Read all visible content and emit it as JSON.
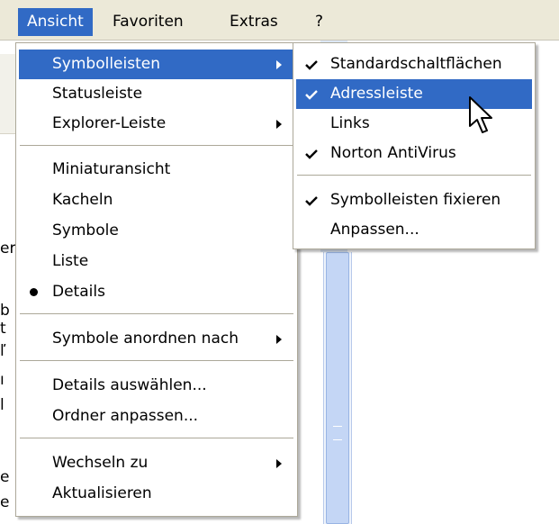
{
  "menubar": {
    "items": [
      {
        "label": "Ansicht",
        "active": true
      },
      {
        "label": "Favoriten",
        "active": false
      },
      {
        "label": "Extras",
        "active": false
      },
      {
        "label": "?",
        "active": false
      }
    ]
  },
  "background": {
    "fragments": [
      "er",
      "b",
      "t",
      "ľ",
      "ı",
      "l",
      "e",
      "e"
    ]
  },
  "view_menu": {
    "items": [
      {
        "label": "Symbolleisten",
        "submenu": true,
        "highlighted": true
      },
      {
        "label": "Statusleiste"
      },
      {
        "label": "Explorer-Leiste",
        "submenu": true
      },
      {
        "label": "Miniaturansicht"
      },
      {
        "label": "Kacheln"
      },
      {
        "label": "Symbole"
      },
      {
        "label": "Liste"
      },
      {
        "label": "Details",
        "bullet": true
      },
      {
        "label": "Symbole anordnen nach",
        "submenu": true
      },
      {
        "label": "Details auswählen..."
      },
      {
        "label": "Ordner anpassen..."
      },
      {
        "label": "Wechseln zu",
        "submenu": true
      },
      {
        "label": "Aktualisieren"
      }
    ]
  },
  "toolbars_submenu": {
    "items": [
      {
        "label": "Standardschaltflächen",
        "checked": true
      },
      {
        "label": "Adressleiste",
        "checked": true,
        "highlighted": true
      },
      {
        "label": "Links",
        "checked": false
      },
      {
        "label": "Norton AntiVirus",
        "checked": true
      },
      {
        "label": "Symbolleisten fixieren",
        "checked": true
      },
      {
        "label": "Anpassen...",
        "checked": false
      }
    ]
  },
  "colors": {
    "menubar_bg": "#ece9d8",
    "highlight": "#316ac5",
    "menu_border": "#aca899"
  },
  "icons": {
    "check": "check-icon",
    "submenu_arrow": "chevron-right-icon",
    "radio": "bullet-icon",
    "cursor": "mouse-pointer-icon"
  }
}
